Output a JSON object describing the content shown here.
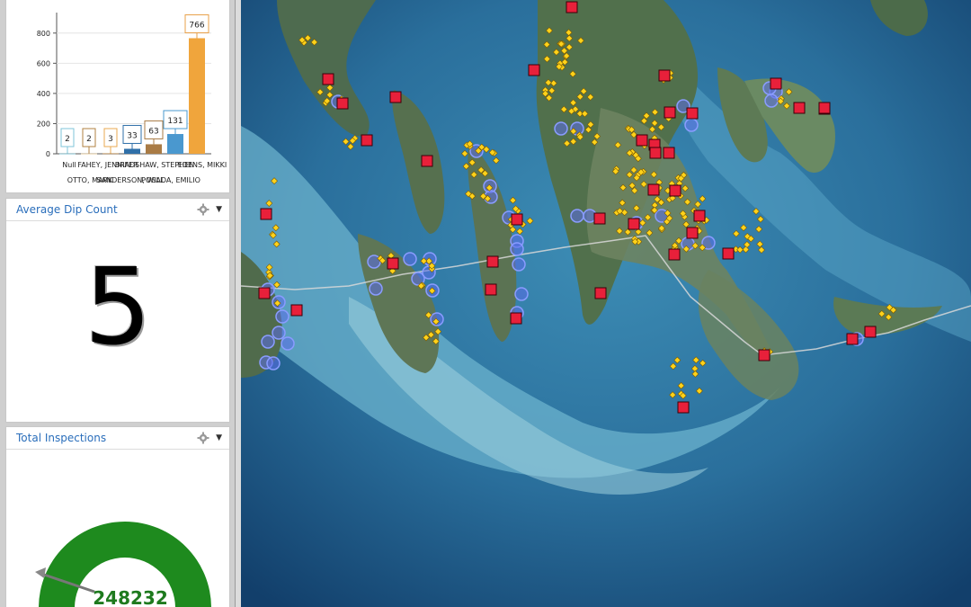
{
  "chart_data": {
    "type": "bar",
    "categories": [
      "Null",
      "OTTO, MARK",
      "FAHEY, JENNIFER",
      "SANDERSON, WILL",
      "BRADSHAW, STEPHEN",
      "POSADA, EMILIO",
      "EDENS, MIKKI"
    ],
    "category_labels": [
      "Null",
      "OTTO, MARK",
      "FAHEY, JENNIFER",
      "SANDERSON, WILL",
      "BRADSHAW, STEPHEN",
      "POSADA, EMILIO",
      "EDENS, MIKKI"
    ],
    "values": [
      2,
      2,
      3,
      33,
      63,
      131,
      766
    ],
    "bar_colors": [
      "#7fc6d9",
      "#f1d1a0",
      "#b08040",
      "#2f6fa8",
      "#a97b45",
      "#4a98cf",
      "#f0a53c"
    ],
    "label_box_colors": [
      "#7fc6d9",
      "#b08040",
      "#e8a850",
      "#2f6fa8",
      "#a97b45",
      "#4a98cf",
      "#e8a04a"
    ],
    "y_ticks": [
      0,
      200,
      400,
      600,
      800
    ],
    "ylim": [
      0,
      900
    ]
  },
  "dip_widget": {
    "title": "Average Dip Count",
    "value": "5"
  },
  "inspections_widget": {
    "title": "Total Inspections",
    "value": "248232",
    "gauge_color": "#1e8a1e"
  },
  "map": {
    "icons": {
      "trap": "red-square-marker",
      "inspection": "yellow-diamond-marker",
      "treatment": "blue-circle-marker"
    },
    "colors": {
      "trap": "#e8203a",
      "inspection": "#ffd21a",
      "treatment": "#5b6ee8"
    }
  }
}
